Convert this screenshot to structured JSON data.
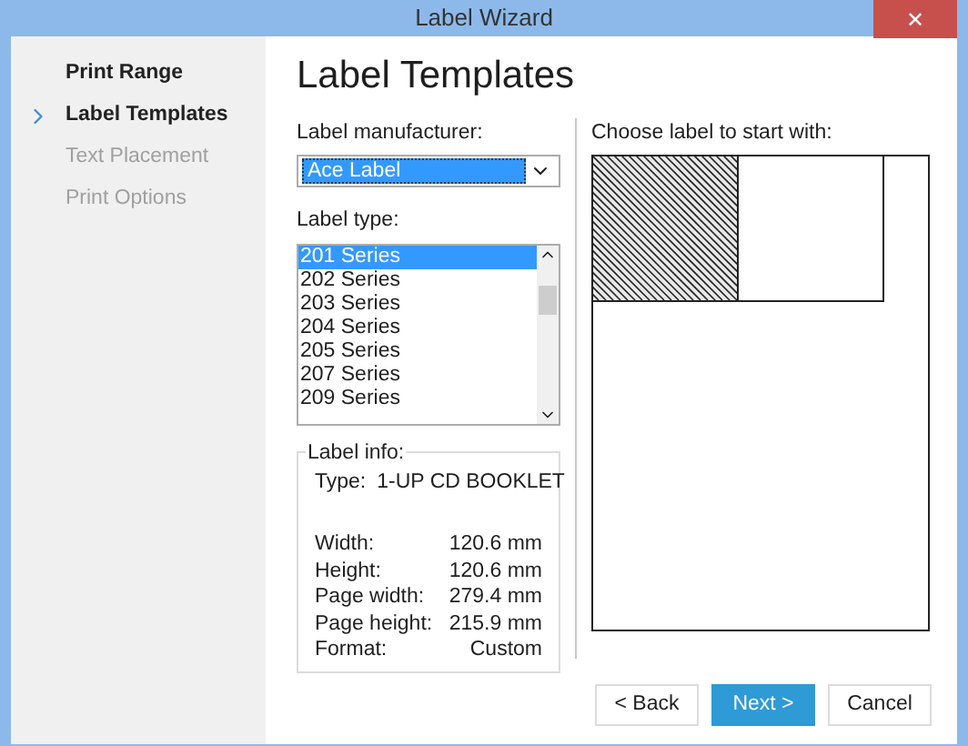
{
  "window": {
    "title": "Label Wizard",
    "close": "✕"
  },
  "steps": [
    {
      "label": "Print Range",
      "selected": false,
      "disabled": false
    },
    {
      "label": "Label Templates",
      "selected": true,
      "disabled": false
    },
    {
      "label": "Text Placement",
      "selected": false,
      "disabled": true
    },
    {
      "label": "Print Options",
      "selected": false,
      "disabled": true
    }
  ],
  "heading": "Label Templates",
  "manufacturer": {
    "label": "Label manufacturer:",
    "value": "Ace Label"
  },
  "label_type": {
    "label": "Label type:",
    "items": [
      {
        "label": "201 Series",
        "selected": true
      },
      {
        "label": "202 Series",
        "selected": false
      },
      {
        "label": "203 Series",
        "selected": false
      },
      {
        "label": "204 Series",
        "selected": false
      },
      {
        "label": "205 Series",
        "selected": false
      },
      {
        "label": "207 Series",
        "selected": false
      },
      {
        "label": "209 Series",
        "selected": false
      }
    ]
  },
  "label_info": {
    "title": "Label info:",
    "type_label": "Type:",
    "type_value": "1-UP CD BOOKLET",
    "rows": [
      {
        "name": "Width:",
        "value": "120.6 mm"
      },
      {
        "name": "Height:",
        "value": "120.6 mm"
      },
      {
        "name": "Page width:",
        "value": "279.4 mm"
      },
      {
        "name": "Page height:",
        "value": "215.9 mm"
      },
      {
        "name": "Format:",
        "value": "Custom"
      }
    ]
  },
  "preview": {
    "label": "Choose label to start with:",
    "labels": [
      {
        "selected": true
      },
      {
        "selected": false
      }
    ]
  },
  "buttons": [
    {
      "label": "< Back",
      "primary": false
    },
    {
      "label": "Next >",
      "primary": true
    },
    {
      "label": "Cancel",
      "primary": false
    }
  ]
}
